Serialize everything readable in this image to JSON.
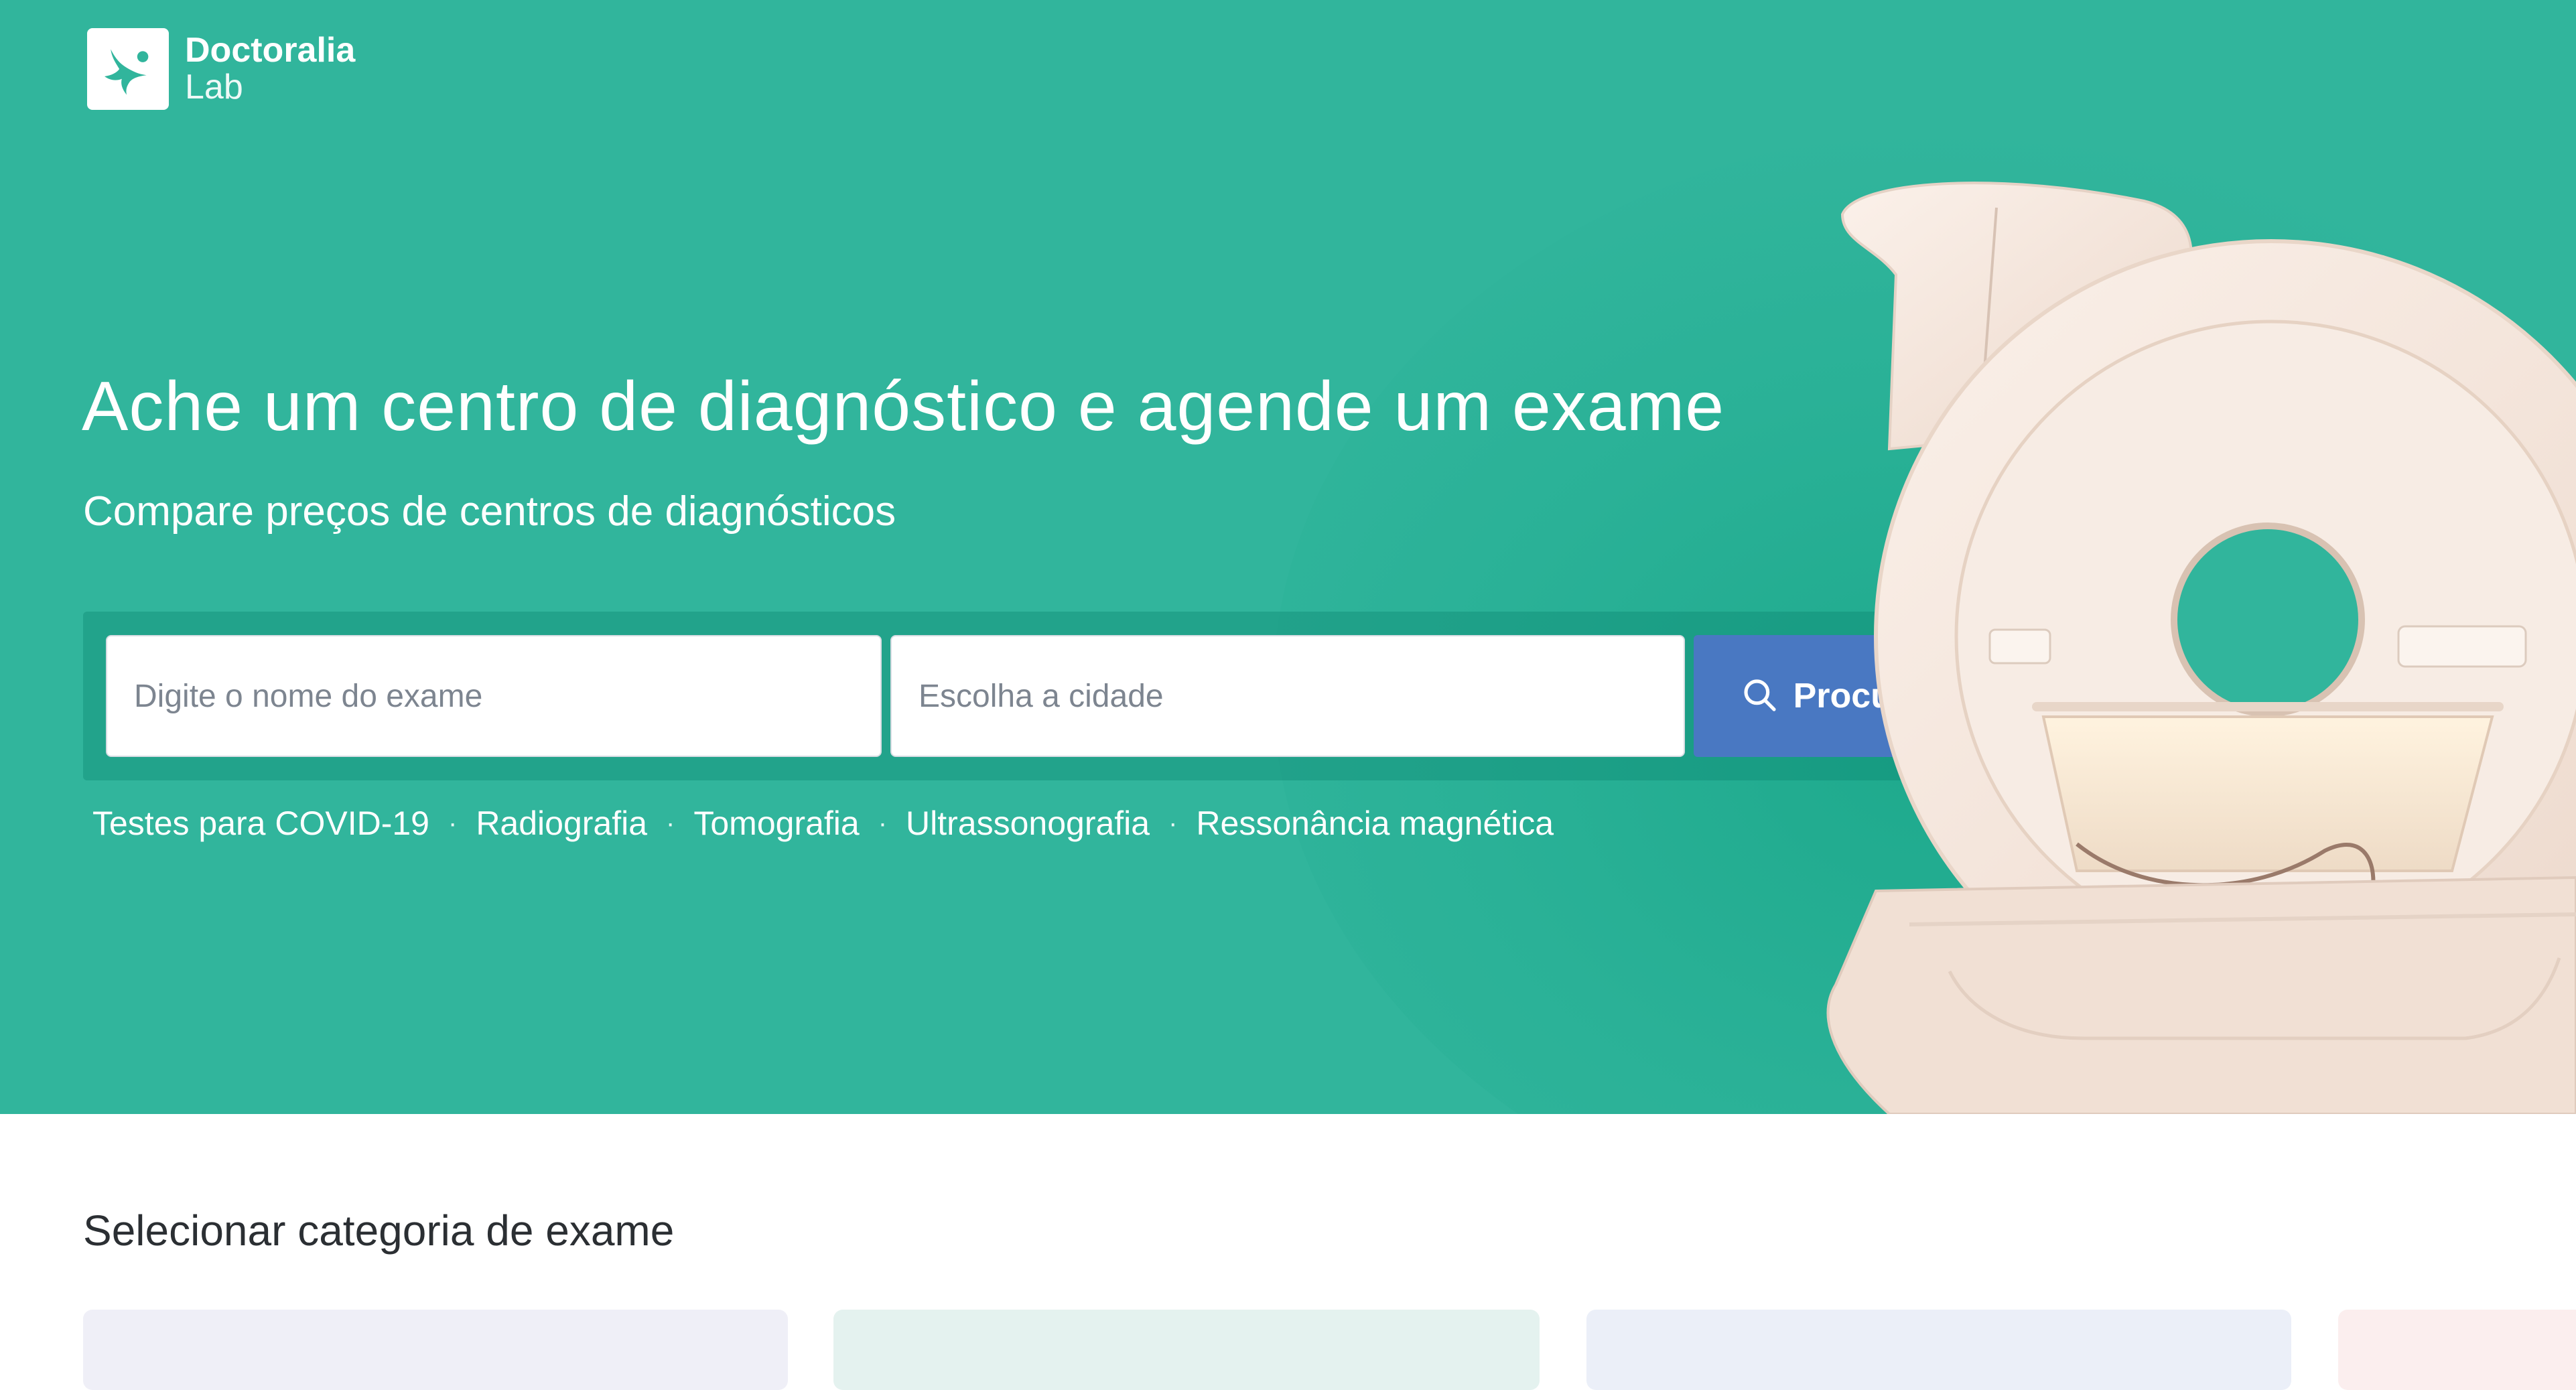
{
  "brand": {
    "name": "Doctoralia",
    "product": "Lab"
  },
  "hero": {
    "headline": "Ache um centro de diagnóstico e agende um exame",
    "subheadline": "Compare preços de centros de diagnósticos"
  },
  "search": {
    "exam_placeholder": "Digite o nome do exame",
    "city_placeholder": "Escolha a cidade",
    "button_label": "Procurar"
  },
  "quick_links": [
    "Testes para COVID-19",
    "Radiografia",
    "Tomografia",
    "Ultrassonografia",
    "Ressonância magnética"
  ],
  "separator": "·",
  "categories": {
    "title": "Selecionar categoria de exame"
  },
  "colors": {
    "hero_background": "#31b59c",
    "search_button": "#4978c2",
    "logo_mark": "#31b59c"
  },
  "icons": {
    "logo": "doctoralia-logo-icon",
    "search": "search-icon"
  }
}
